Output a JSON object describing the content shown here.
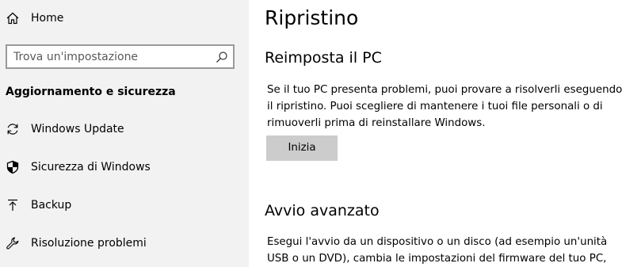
{
  "sidebar": {
    "home_label": "Home",
    "search": {
      "placeholder": "Trova un'impostazione",
      "value": ""
    },
    "section_heading": "Aggiornamento e sicurezza",
    "items": [
      {
        "label": "Windows Update",
        "icon": "sync-icon"
      },
      {
        "label": "Sicurezza di Windows",
        "icon": "shield-icon"
      },
      {
        "label": "Backup",
        "icon": "upload-arrow-icon"
      },
      {
        "label": "Risoluzione problemi",
        "icon": "wrench-icon"
      }
    ]
  },
  "main": {
    "title": "Ripristino",
    "reset": {
      "heading": "Reimposta il PC",
      "lines": [
        "Se il tuo PC presenta problemi, puoi provare a risolverli eseguendo",
        "il ripristino. Puoi scegliere di mantenere i tuoi file personali o di",
        "rimuoverli prima di reinstallare Windows."
      ],
      "button_label": "Inizia"
    },
    "advanced": {
      "heading": "Avvio avanzato",
      "lines": [
        "Esegui l'avvio da un dispositivo o un disco (ad esempio un'unità",
        "USB o un DVD), cambia le impostazioni del firmware del tuo PC,"
      ]
    }
  },
  "colors": {
    "sidebar_bg": "#f2f2f2",
    "button_bg": "#cccccc",
    "search_border": "#999999"
  }
}
